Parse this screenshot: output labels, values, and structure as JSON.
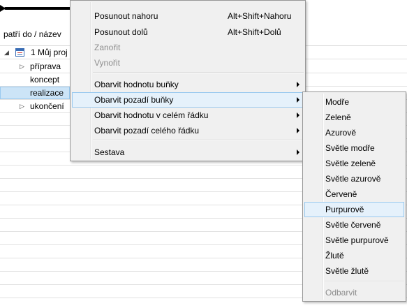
{
  "grid": {
    "column_header": "patří do / název",
    "rows": [
      {
        "label": "1 Můj proj",
        "expander": "◢"
      },
      {
        "label": "příprava",
        "expander": "▷"
      },
      {
        "label": "koncept",
        "expander": ""
      },
      {
        "label": "realizace",
        "expander": ""
      },
      {
        "label": "ukončení",
        "expander": "▷"
      }
    ]
  },
  "context_menu": {
    "items": [
      {
        "label": "Posunout nahoru",
        "shortcut": "Alt+Shift+Nahoru",
        "enabled": true
      },
      {
        "label": "Posunout dolů",
        "shortcut": "Alt+Shift+Dolů",
        "enabled": true
      },
      {
        "label": "Zanořit",
        "shortcut": "",
        "enabled": false
      },
      {
        "label": "Vynořit",
        "shortcut": "",
        "enabled": false
      },
      {
        "label": "Obarvit hodnotu buňky",
        "submenu": true,
        "enabled": true
      },
      {
        "label": "Obarvit pozadí buňky",
        "submenu": true,
        "enabled": true,
        "highlighted": true
      },
      {
        "label": "Obarvit hodnotu v celém řádku",
        "submenu": true,
        "enabled": true
      },
      {
        "label": "Obarvit pozadí celého řádku",
        "submenu": true,
        "enabled": true
      },
      {
        "label": "Sestava",
        "submenu": true,
        "enabled": true
      }
    ]
  },
  "color_submenu": {
    "items": [
      {
        "label": "Modře"
      },
      {
        "label": "Zeleně"
      },
      {
        "label": "Azurově"
      },
      {
        "label": "Světle modře"
      },
      {
        "label": "Světle zeleně"
      },
      {
        "label": "Světle azurově"
      },
      {
        "label": "Červeně"
      },
      {
        "label": "Purpurově",
        "highlighted": true
      },
      {
        "label": "Světle červeně"
      },
      {
        "label": "Světle purpurově"
      },
      {
        "label": "Žlutě"
      },
      {
        "label": "Světle žlutě"
      },
      {
        "label": "Odbarvit",
        "enabled": false
      }
    ]
  },
  "colors": {
    "menu_bg": "#f0f0f0",
    "highlight_bg": "#e5f1fb",
    "highlight_border": "#99c9ef",
    "selection_bg": "#cce4f7",
    "disabled_text": "#8d8d8d"
  }
}
